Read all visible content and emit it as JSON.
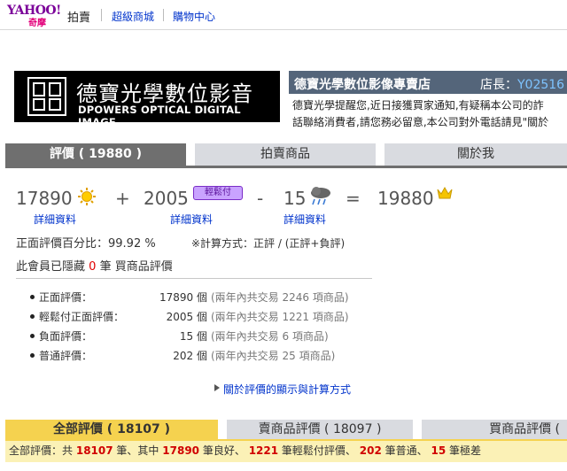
{
  "topbar": {
    "logo_word": "YAHOO!",
    "logo_sub": "奇摩",
    "auction": "拍賣",
    "links": [
      "超級商城",
      "購物中心"
    ]
  },
  "store": {
    "logo_cn": "德寶光學數位影音",
    "logo_en": "DPOWERS OPTICAL DIGITAL IMAGE",
    "name": "德寶光學數位影像專賣店",
    "owner_label": "店長：",
    "owner_id": "Y02516",
    "notice_1": "德寶光學提醒您,近日接獲買家通知,有疑稱本公司的詐",
    "notice_2": "話聯絡消費者,請您務必留意,本公司對外電話請見\"關於"
  },
  "tabs": [
    {
      "label": "評價 ( 19880 )",
      "active": true
    },
    {
      "label": "拍賣商品",
      "active": false
    },
    {
      "label": "關於我",
      "active": false
    }
  ],
  "score": {
    "positive": "17890",
    "plus": "+",
    "relaxed": "2005",
    "relaxed_badge": "輕鬆付",
    "minus": "-",
    "negative": "15",
    "equals": "=",
    "total": "19880",
    "detail_link": "詳細資料"
  },
  "summary": {
    "positive_pct": "正面評價百分比：99.92 %",
    "calc_method": "※計算方式：正評 / (正評+負評)",
    "hidden_prefix": "此會員已隱藏",
    "hidden_count": "0",
    "hidden_suffix": "筆 買商品評價"
  },
  "stats": [
    {
      "label": "正面評價：",
      "count": "17890 個",
      "note": "(兩年內共交易 2246 項商品)"
    },
    {
      "label": "輕鬆付正面評價：",
      "count": "2005 個",
      "note": "(兩年內共交易 1221 項商品)"
    },
    {
      "label": "負面評價：",
      "count": "15 個",
      "note": "(兩年內共交易 6 項商品)"
    },
    {
      "label": "普通評價：",
      "count": "202 個",
      "note": "(兩年內共交易 25 項商品)"
    }
  ],
  "about_link": "關於評價的顯示與計算方式",
  "bottom_tabs": [
    {
      "label": "全部評價 ( 18107 )",
      "active": true
    },
    {
      "label": "賣商品評價 ( 18097 )",
      "active": false
    },
    {
      "label": "買商品評價 (",
      "active": false
    }
  ],
  "summary_bar": {
    "p1": "全部評價：共",
    "total": "18107",
    "p2": "筆、其中",
    "good": "17890",
    "p3": "筆良好、",
    "relaxed": "1221",
    "p4": "筆輕鬆付評價、",
    "normal": "202",
    "p5": "筆普通、",
    "bad": "15",
    "p6": "筆極差"
  },
  "colors": {
    "tab_active": "#6f6f6f",
    "tab_inactive": "#d9dbe0",
    "store_header": "#54657a",
    "bottom_tab_active": "#f5d24f",
    "summary_bg": "#fbf1b6",
    "link": "#0033cc",
    "red": "#d00000"
  }
}
